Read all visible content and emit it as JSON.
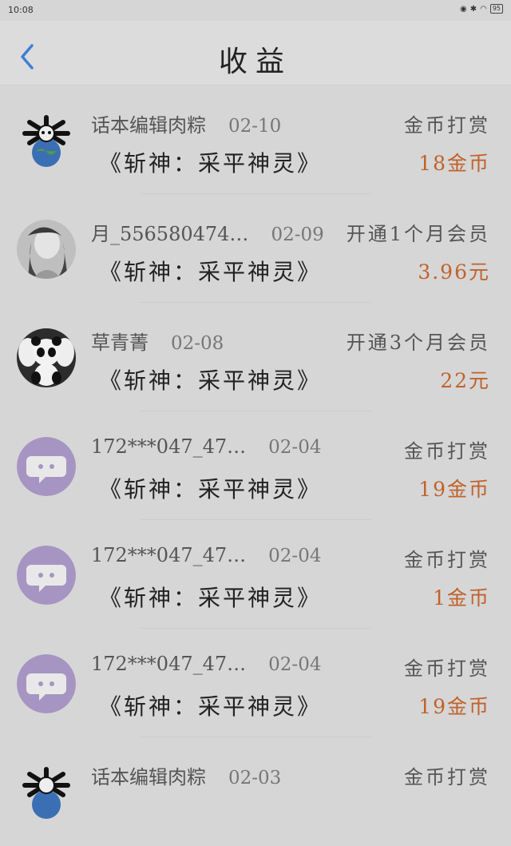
{
  "status_bar": {
    "time": "10:08",
    "battery": "95"
  },
  "header": {
    "title": "收益"
  },
  "records": [
    {
      "avatar": "bone-globe-avatar",
      "user": "话本编辑肉粽",
      "date": "02-10",
      "book": "《斩神：采平神灵》",
      "type": "金币打赏",
      "amount": "18金币"
    },
    {
      "avatar": "portrait-avatar",
      "user": "月_556580474…",
      "date": "02-09",
      "book": "《斩神：采平神灵》",
      "type": "开通1个月会员",
      "amount": "3.96元"
    },
    {
      "avatar": "panda-avatar",
      "user": "草青菁",
      "date": "02-08",
      "book": "《斩神：采平神灵》",
      "type": "开通3个月会员",
      "amount": "22元"
    },
    {
      "avatar": "default-avatar",
      "user": "172***047_47…",
      "date": "02-04",
      "book": "《斩神：采平神灵》",
      "type": "金币打赏",
      "amount": "19金币"
    },
    {
      "avatar": "default-avatar",
      "user": "172***047_47…",
      "date": "02-04",
      "book": "《斩神：采平神灵》",
      "type": "金币打赏",
      "amount": "1金币"
    },
    {
      "avatar": "default-avatar",
      "user": "172***047_47…",
      "date": "02-04",
      "book": "《斩神：采平神灵》",
      "type": "金币打赏",
      "amount": "19金币"
    },
    {
      "avatar": "bone-globe-avatar",
      "user": "话本编辑肉粽",
      "date": "02-03",
      "book": "",
      "type": "金币打赏",
      "amount": ""
    }
  ]
}
